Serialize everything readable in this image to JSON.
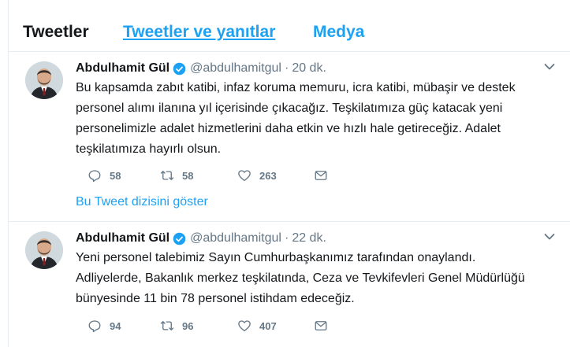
{
  "tabs": [
    {
      "label": "Tweetler"
    },
    {
      "label": "Tweetler ve yanıtlar"
    },
    {
      "label": "Medya"
    }
  ],
  "tweets": [
    {
      "name": "Abdulhamit Gül",
      "handle": "@abdulhamitgul",
      "dot": "·",
      "time": "20 dk.",
      "lines": [
        "Bu kapsamda zabıt katibi, infaz koruma memuru, icra katibi, mübaşir ve destek",
        "personel alımı ilanına yıl içerisinde çıkacağız. Teşkilatımıza güç katacak yeni",
        "personelimizle adalet hizmetlerini daha etkin ve hızlı hale getireceğiz. Adalet",
        "teşkilatımıza hayırlı olsun."
      ],
      "replies": "58",
      "retweets": "58",
      "likes": "263",
      "thread_link": "Bu Tweet dizisini göster"
    },
    {
      "name": "Abdulhamit Gül",
      "handle": "@abdulhamitgul",
      "dot": "·",
      "time": "22 dk.",
      "lines": [
        "Yeni personel talebimiz Sayın Cumhurbaşkanımız tarafından onaylandı.",
        "Adliyelerde, Bakanlık merkez teşkilatında, Ceza ve Tevkifevleri Genel Müdürlüğü",
        "bünyesinde 11 bin 78 personel istihdam edeceğiz."
      ],
      "replies": "94",
      "retweets": "96",
      "likes": "407"
    }
  ],
  "colors": {
    "accent": "#1da1f2",
    "text": "#14171a",
    "muted": "#657786",
    "divider": "#e6ecf0"
  }
}
